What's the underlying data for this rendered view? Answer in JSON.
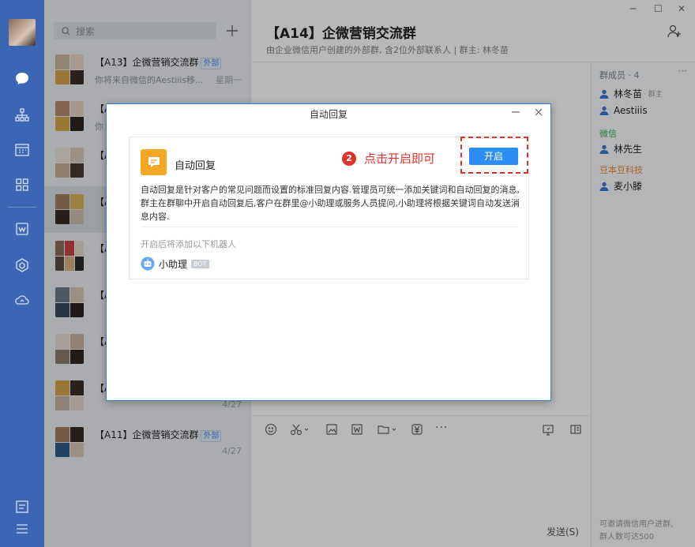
{
  "window": {
    "minimize": "─",
    "maximize": "☐",
    "close": "✕"
  },
  "sidebar_nav": [
    "chat-icon",
    "org-icon",
    "calendar-icon",
    "apps-icon",
    "doc-icon",
    "cube-icon",
    "cloud-icon",
    "notes-icon",
    "menu-icon"
  ],
  "chat_list": {
    "search_placeholder": "搜索",
    "items": [
      {
        "title": "【A13】企微营销交流群",
        "tag": "外部",
        "preview": "你将来自微信的Aestiiis移...",
        "time": "星期一"
      },
      {
        "title": "【A",
        "tag": "",
        "preview": "你",
        "time": ""
      },
      {
        "title": "【A",
        "tag": "",
        "preview": "",
        "time": ""
      },
      {
        "title": "【A",
        "tag": "",
        "preview": "",
        "time": ""
      },
      {
        "title": "【A",
        "tag": "",
        "preview": "",
        "time": ""
      },
      {
        "title": "【A",
        "tag": "",
        "preview": "",
        "time": ""
      },
      {
        "title": "【A",
        "tag": "",
        "preview": "",
        "time": ""
      },
      {
        "title": "【A",
        "tag": "",
        "preview": "",
        "time": "4/27"
      },
      {
        "title": "【A11】企微营销交流群",
        "tag": "外部",
        "preview": "",
        "time": "4/27"
      }
    ]
  },
  "conversation": {
    "title": "【A14】企微营销交流群",
    "subtitle": "由企业微信用户创建的外部群, 含2位外部联系人 | 群主: 林冬苗",
    "send_label": "发送(S)"
  },
  "members": {
    "header": "群成员 · 4",
    "more": "···",
    "owner": {
      "name": "林冬苗",
      "role": "· 群主"
    },
    "m2": "Aestiiis",
    "group_wechat": "微信",
    "m3": "林先生",
    "group_company": "豆本豆科技",
    "m4": "麦小滕",
    "invite_line1": "可邀请微信用户进群,",
    "invite_line2": "群人数可达500"
  },
  "dialog": {
    "title": "自动回复",
    "app_name": "自动回复",
    "description": "自动回复是针对客户的常见问题而设置的标准回复内容.管理员可统一添加关键词和自动回复的消息,群主在群聊中开启自动回复后,客户在群里@小助理或服务人员提问,小助理将根据关键词自动发送消息内容.",
    "hint": "开启后将添加以下机器人",
    "bot_name": "小助理",
    "bot_badge": "BOT",
    "open_button": "开启",
    "step_number": "2",
    "step_text": "点击开启即可",
    "accent": "#2c8ef2",
    "annotation_color": "#e0322c"
  }
}
